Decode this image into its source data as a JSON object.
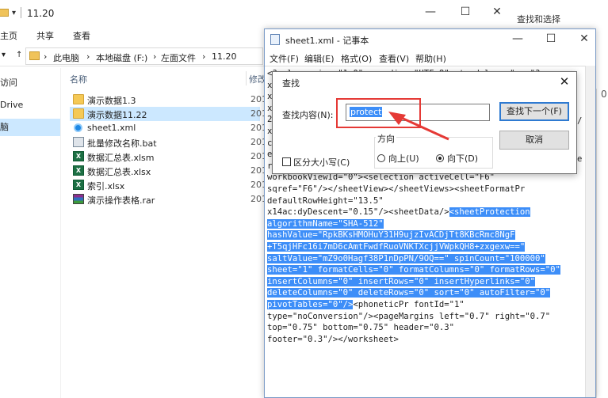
{
  "explorer": {
    "title": "11.20",
    "tabs": [
      "主页",
      "共享",
      "查看"
    ],
    "breadcrumb": [
      "此电脑",
      "本地磁盘 (F:)",
      "左面文件",
      "11.20"
    ],
    "nav_items": [
      "访问",
      "Drive",
      "脑"
    ],
    "columns": {
      "name": "名称",
      "modified": "修改"
    },
    "files": [
      {
        "name": "演示数据1.3",
        "type": "folder",
        "date": "201"
      },
      {
        "name": "演示数据11.22",
        "type": "folder",
        "date": "201"
      },
      {
        "name": "sheet1.xml",
        "type": "xml",
        "date": "201"
      },
      {
        "name": "批量修改名称.bat",
        "type": "bat",
        "date": "201"
      },
      {
        "name": "数据汇总表.xlsm",
        "type": "xls",
        "date": "201"
      },
      {
        "name": "数据汇总表.xlsx",
        "type": "xls",
        "date": "201"
      },
      {
        "name": "索引.xlsx",
        "type": "xls",
        "date": "201"
      },
      {
        "name": "演示操作表格.rar",
        "type": "rar",
        "date": "201"
      }
    ]
  },
  "background": {
    "ribbon_label": "查找和选择",
    "col_digit": "0"
  },
  "notepad": {
    "title": "sheet1.xml - 记事本",
    "menu": [
      "文件(F)",
      "编辑(E)",
      "格式(O)",
      "查看(V)",
      "帮助(H)"
    ],
    "lines": [
      {
        "t": "<?xml version=\"1.0\" encoding=\"UTF-8\" standalone=\"yes\"?>",
        "h": ""
      },
      {
        "t": "x",
        "h": ""
      },
      {
        "t": "x",
        "h": ""
      },
      {
        "t": "x",
        "h": ""
      },
      {
        "t": "2",
        "h": ""
      },
      {
        "t": "x",
        "h": ""
      },
      {
        "t": "c",
        "h": ""
      },
      {
        "t": "e",
        "h": ""
      },
      {
        "t": "r",
        "h": ""
      },
      {
        "t": "workbookViewId=\"0\"><selection activeCell=\"F6\"",
        "h": ""
      },
      {
        "t": "sqref=\"F6\"/></sheetView></sheetViews><sheetFormatPr",
        "h": ""
      },
      {
        "t": "defaultRowHeight=\"13.5\"",
        "h": ""
      },
      {
        "t": "x14ac:dyDescent=\"0.15\"/><sheetData/>",
        "h": "<sheetProtection"
      },
      {
        "t": "",
        "h": "algorithmName=\"SHA-512\""
      },
      {
        "t": "",
        "h": "hashValue=\"RpkBKsHMOHuY31H9ujzIvACDjTt8KBcRmc8NgF"
      },
      {
        "t": "",
        "h": "+T5qjHFc16i7mD6cAmtFwdfRuoVNKTXcjjVWpkQH8+zxgexw==\""
      },
      {
        "t": "",
        "h": "saltValue=\"mZ9o0Hagf38P1nDpPN/9OQ==\" spinCount=\"100000\""
      },
      {
        "t": "",
        "h": "sheet=\"1\" formatCells=\"0\" formatColumns=\"0\" formatRows=\"0\""
      },
      {
        "t": "",
        "h": "insertColumns=\"0\" insertRows=\"0\" insertHyperlinks=\"0\""
      },
      {
        "t": "",
        "h": "deleteColumns=\"0\" deleteRows=\"0\" sort=\"0\" autoFilter=\"0\""
      },
      {
        "t": "",
        "h": "pivotTables=\"0\"/>",
        "tail": "<phoneticPr fontId=\"1\""
      },
      {
        "t": "type=\"noConversion\"/><pageMargins left=\"0.7\" right=\"0.7\"",
        "h": ""
      },
      {
        "t": "top=\"0.75\" bottom=\"0.75\" header=\"0.3\"",
        "h": ""
      },
      {
        "t": "footer=\"0.3\"/></worksheet>",
        "h": ""
      }
    ],
    "right_fragments": [
      "/",
      "e"
    ]
  },
  "find": {
    "title": "查找",
    "label": "查找内容(N):",
    "value": "protect",
    "find_next": "查找下一个(F)",
    "cancel": "取消",
    "direction_label": "方向",
    "up": "向上(U)",
    "down": "向下(D)",
    "match_case": "区分大小写(C)"
  }
}
